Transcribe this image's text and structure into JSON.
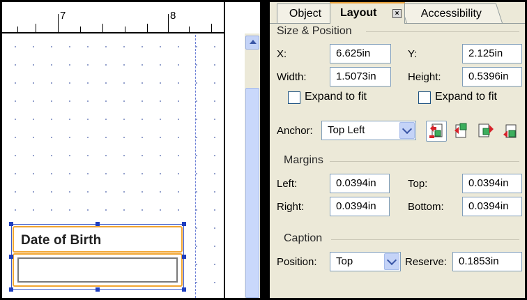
{
  "ruler": {
    "labels": [
      "7",
      "8"
    ]
  },
  "field": {
    "caption": "Date of Birth"
  },
  "panel": {
    "tabs": {
      "object": "Object",
      "layout": "Layout",
      "accessibility": "Accessibility",
      "close": "×"
    },
    "size_position": {
      "heading": "Size & Position",
      "x_label": "X:",
      "x_value": "6.625in",
      "y_label": "Y:",
      "y_value": "2.125in",
      "width_label": "Width:",
      "width_value": "1.5073in",
      "height_label": "Height:",
      "height_value": "0.5396in",
      "expand_width_label": "Expand to fit",
      "expand_width_checked": false,
      "expand_height_label": "Expand to fit",
      "expand_height_checked": false,
      "anchor_label": "Anchor:",
      "anchor_value": "Top Left"
    },
    "margins": {
      "heading": "Margins",
      "left_label": "Left:",
      "left_value": "0.0394in",
      "top_label": "Top:",
      "top_value": "0.0394in",
      "right_label": "Right:",
      "right_value": "0.0394in",
      "bottom_label": "Bottom:",
      "bottom_value": "0.0394in"
    },
    "caption": {
      "heading": "Caption",
      "position_label": "Position:",
      "position_value": "Top",
      "reserve_label": "Reserve:",
      "reserve_value": "0.1853in"
    },
    "colors": {
      "accent": "#f2a530",
      "selection": "#1f3fbf",
      "panel_bg": "#ece9d8"
    },
    "icons": [
      "anchor-top-left-icon",
      "anchor-top-right-icon",
      "anchor-bottom-left-icon",
      "anchor-bottom-right-icon"
    ]
  }
}
